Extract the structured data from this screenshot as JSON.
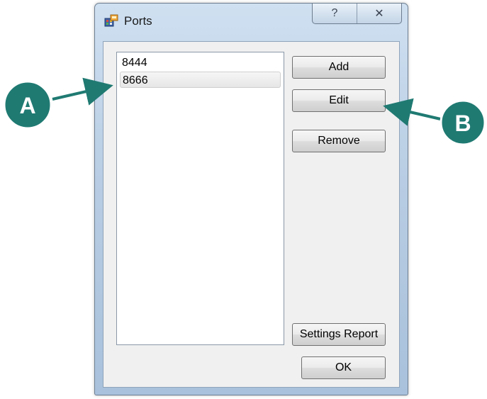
{
  "window": {
    "title": "Ports",
    "help_glyph": "?",
    "close_glyph": "✕"
  },
  "ports": {
    "items": [
      "8444",
      "8666"
    ],
    "selected_index": 1
  },
  "buttons": {
    "add": "Add",
    "edit": "Edit",
    "remove": "Remove",
    "settings_report": "Settings Report",
    "ok": "OK"
  },
  "annotations": {
    "a_label": "A",
    "b_label": "B",
    "color": "#1f7a72"
  },
  "icons": {
    "app_icon": "ports-app-icon",
    "help": "help-icon",
    "close": "close-icon"
  }
}
